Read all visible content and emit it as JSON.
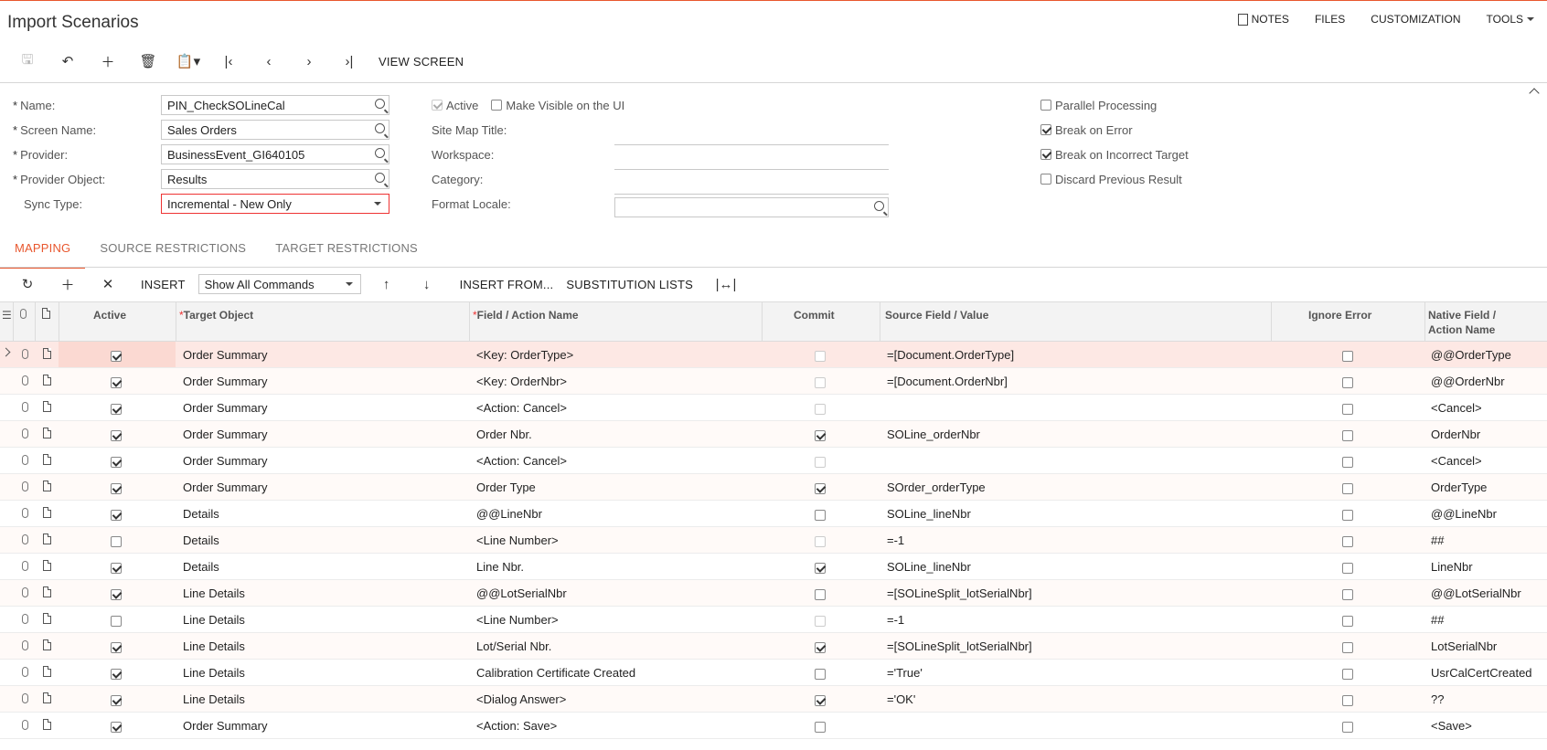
{
  "app": {
    "title": "Import Scenarios"
  },
  "topnav": {
    "notes": "NOTES",
    "files": "FILES",
    "customization": "CUSTOMIZATION",
    "tools": "TOOLS"
  },
  "toolbar": {
    "view_screen": "VIEW SCREEN"
  },
  "form": {
    "name_label": "Name:",
    "name_value": "PIN_CheckSOLineCal",
    "screen_label": "Screen Name:",
    "screen_value": "Sales Orders",
    "provider_label": "Provider:",
    "provider_value": "BusinessEvent_GI640105",
    "provider_object_label": "Provider Object:",
    "provider_object_value": "Results",
    "sync_label": "Sync Type:",
    "sync_value": "Incremental - New Only",
    "active_label": "Active",
    "visible_label": "Make Visible on the UI",
    "sitemap_label": "Site Map Title:",
    "workspace_label": "Workspace:",
    "category_label": "Category:",
    "locale_label": "Format Locale:",
    "parallel_label": "Parallel Processing",
    "break_error_label": "Break on Error",
    "break_target_label": "Break on Incorrect Target",
    "discard_label": "Discard Previous Result"
  },
  "tabs": {
    "mapping": "MAPPING",
    "source": "SOURCE RESTRICTIONS",
    "target": "TARGET RESTRICTIONS"
  },
  "gridbar": {
    "insert": "INSERT",
    "show_all": "Show All Commands",
    "insert_from": "INSERT FROM...",
    "substitution": "SUBSTITUTION LISTS"
  },
  "columns": {
    "active": "Active",
    "target_object": "Target Object",
    "field_action": "Field / Action Name",
    "commit": "Commit",
    "source_field": "Source Field / Value",
    "ignore_error": "Ignore Error",
    "native_1": "Native Field /",
    "native_2": "Action Name"
  },
  "rows": [
    {
      "active": true,
      "target": "Order Summary",
      "field": "<Key: OrderType>",
      "commit": false,
      "commit_dim": true,
      "source": "=[Document.OrderType]",
      "ignore": false,
      "native": "@@OrderType"
    },
    {
      "active": true,
      "target": "Order Summary",
      "field": "<Key: OrderNbr>",
      "commit": false,
      "commit_dim": true,
      "source": "=[Document.OrderNbr]",
      "ignore": false,
      "native": "@@OrderNbr"
    },
    {
      "active": true,
      "target": "Order Summary",
      "field": "<Action: Cancel>",
      "commit": false,
      "commit_dim": true,
      "source": "",
      "ignore": false,
      "native": "<Cancel>"
    },
    {
      "active": true,
      "target": "Order Summary",
      "field": "Order Nbr.",
      "commit": true,
      "commit_dim": false,
      "source": "SOLine_orderNbr",
      "ignore": false,
      "native": "OrderNbr"
    },
    {
      "active": true,
      "target": "Order Summary",
      "field": "<Action: Cancel>",
      "commit": false,
      "commit_dim": true,
      "source": "",
      "ignore": false,
      "native": "<Cancel>"
    },
    {
      "active": true,
      "target": "Order Summary",
      "field": "Order Type",
      "commit": true,
      "commit_dim": false,
      "source": "SOrder_orderType",
      "ignore": false,
      "native": "OrderType"
    },
    {
      "active": true,
      "target": "Details",
      "field": "@@LineNbr",
      "commit": false,
      "commit_dim": false,
      "source": "SOLine_lineNbr",
      "ignore": false,
      "native": "@@LineNbr"
    },
    {
      "active": false,
      "target": "Details",
      "field": "<Line Number>",
      "commit": false,
      "commit_dim": true,
      "source": "=-1",
      "ignore": false,
      "native": "##"
    },
    {
      "active": true,
      "target": "Details",
      "field": "Line Nbr.",
      "commit": true,
      "commit_dim": false,
      "source": "SOLine_lineNbr",
      "ignore": false,
      "native": "LineNbr"
    },
    {
      "active": true,
      "target": "Line Details",
      "field": "@@LotSerialNbr",
      "commit": false,
      "commit_dim": false,
      "source": "=[SOLineSplit_lotSerialNbr]",
      "ignore": false,
      "native": "@@LotSerialNbr"
    },
    {
      "active": false,
      "target": "Line Details",
      "field": "<Line Number>",
      "commit": false,
      "commit_dim": true,
      "source": "=-1",
      "ignore": false,
      "native": "##"
    },
    {
      "active": true,
      "target": "Line Details",
      "field": "Lot/Serial Nbr.",
      "commit": true,
      "commit_dim": false,
      "source": "=[SOLineSplit_lotSerialNbr]",
      "ignore": false,
      "native": "LotSerialNbr"
    },
    {
      "active": true,
      "target": "Line Details",
      "field": "Calibration Certificate Created",
      "commit": false,
      "commit_dim": false,
      "source": "='True'",
      "ignore": false,
      "native": "UsrCalCertCreated"
    },
    {
      "active": true,
      "target": "Line Details",
      "field": "<Dialog Answer>",
      "commit": true,
      "commit_dim": false,
      "source": "='OK'",
      "ignore": false,
      "native": "??"
    },
    {
      "active": true,
      "target": "Order Summary",
      "field": "<Action: Save>",
      "commit": false,
      "commit_dim": false,
      "source": "",
      "ignore": false,
      "native": "<Save>"
    }
  ]
}
